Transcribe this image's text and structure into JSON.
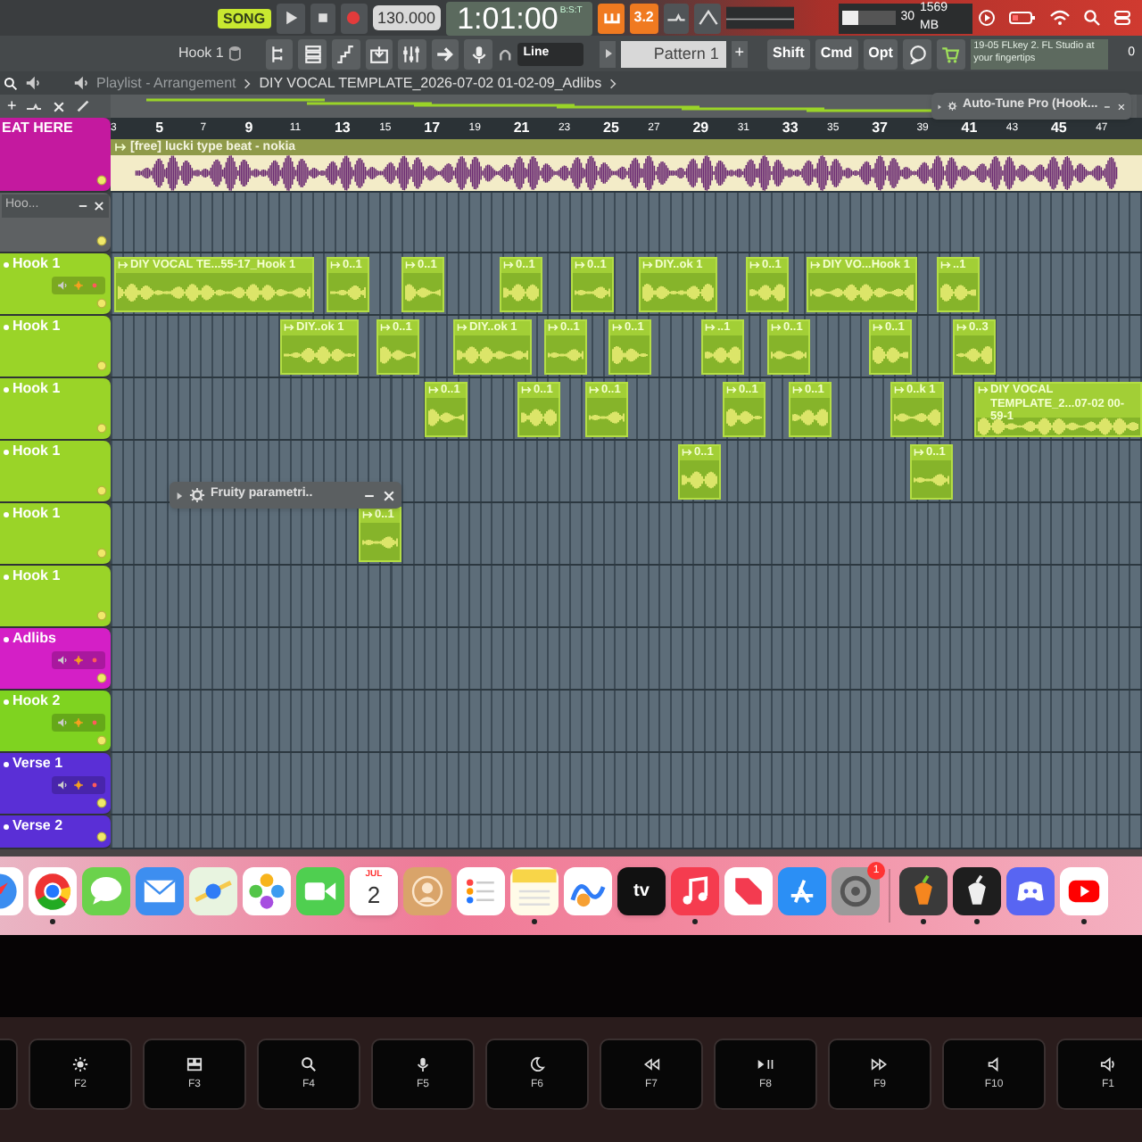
{
  "transport": {
    "mode": "SONG",
    "tempo": "130.000",
    "time": "1:01:00",
    "time_format": "B:S:T",
    "precount": "3.2"
  },
  "resources": {
    "cpu": "30",
    "level": 0.3,
    "memory": "1569 MB",
    "polyphony": "0"
  },
  "toolbar": {
    "channel": "Hook 1",
    "snap": "Line",
    "pattern": "Pattern 1",
    "add_pattern": "+",
    "add_track": "+",
    "modifiers": [
      "Shift",
      "Cmd",
      "Opt"
    ],
    "hint": "19-05 FLkey 2. FL Studio at your fingertips"
  },
  "playlist": {
    "title": "Playlist - Arrangement",
    "path": "DIY VOCAL TEMPLATE_2026-07-02 01-02-09_Adlibs",
    "ruler": [
      "3",
      "5",
      "7",
      "9",
      "11",
      "13",
      "15",
      "17",
      "19",
      "21",
      "23",
      "25",
      "27",
      "29",
      "31",
      "33",
      "35",
      "37",
      "39",
      "41",
      "43",
      "45",
      "47"
    ],
    "tracks": [
      {
        "name": "EAT HERE",
        "color": "#c4199f",
        "kind": "audio",
        "controls": false,
        "clips": [
          {
            "label": "[free] lucki type beat - nokia"
          }
        ]
      },
      {
        "name": "Hoo...",
        "color": "#5e6163",
        "kind": "window",
        "controls": false
      },
      {
        "name": "Hook 1",
        "color": "#9ad428",
        "kind": "lane",
        "controls": true,
        "clips": [
          {
            "label": "DIY VOCAL TE...55-17_Hook 1"
          },
          {
            "label": "0..1"
          },
          {
            "label": "0..1"
          },
          {
            "label": "0..1"
          },
          {
            "label": "0..1"
          },
          {
            "label": "DIY..ok 1"
          },
          {
            "label": "0..1"
          },
          {
            "label": "DIY VO...Hook 1"
          },
          {
            "label": "..1"
          }
        ]
      },
      {
        "name": "Hook 1",
        "color": "#9ad428",
        "kind": "lane",
        "controls": false,
        "clips": [
          {
            "label": "DIY..ok 1"
          },
          {
            "label": "0..1"
          },
          {
            "label": "DIY..ok 1"
          },
          {
            "label": "0..1"
          },
          {
            "label": "0..1"
          },
          {
            "label": "..1"
          },
          {
            "label": "0..1"
          },
          {
            "label": "0..1"
          },
          {
            "label": "0..3"
          }
        ]
      },
      {
        "name": "Hook 1",
        "color": "#9ad428",
        "kind": "lane",
        "controls": false,
        "clips": [
          {
            "label": "0..1"
          },
          {
            "label": "0..1"
          },
          {
            "label": "0..1"
          },
          {
            "label": "0..1"
          },
          {
            "label": "0..1"
          },
          {
            "label": "0..k 1"
          },
          {
            "label": "DIY VOCAL TEMPLATE_2...07-02 00-59-1"
          }
        ]
      },
      {
        "name": "Hook 1",
        "color": "#9ad428",
        "kind": "lane",
        "controls": false,
        "clips": [
          {
            "label": "0..1"
          },
          {
            "label": "0..1"
          }
        ]
      },
      {
        "name": "Hook 1",
        "color": "#9ad428",
        "kind": "lane",
        "controls": false,
        "clips": [
          {
            "label": "0..1"
          }
        ]
      },
      {
        "name": "Hook 1",
        "color": "#9ad428",
        "kind": "lane",
        "controls": false
      },
      {
        "name": "Adlibs",
        "color": "#d41fc6",
        "kind": "lane",
        "controls": true
      },
      {
        "name": "Hook 2",
        "color": "#7fd320",
        "kind": "lane",
        "controls": true
      },
      {
        "name": "Verse 1",
        "color": "#5a2fd6",
        "kind": "lane",
        "controls": true
      },
      {
        "name": "Verse 2",
        "color": "#5a2fd6",
        "kind": "lane",
        "controls": false
      }
    ]
  },
  "plugin_windows": [
    {
      "title": "Auto-Tune Pro (Hook..."
    },
    {
      "title": "Fruity parametri.."
    }
  ],
  "dock": [
    {
      "kind": "compass",
      "running": false
    },
    {
      "kind": "ball",
      "running": true
    },
    {
      "kind": "chat",
      "running": false
    },
    {
      "kind": "mail",
      "running": false
    },
    {
      "kind": "map",
      "running": false
    },
    {
      "kind": "flower",
      "running": false
    },
    {
      "kind": "video",
      "running": false
    },
    {
      "kind": "calendar",
      "running": false,
      "month": "JUL",
      "day": "2"
    },
    {
      "kind": "contacts",
      "running": false
    },
    {
      "kind": "list",
      "running": false
    },
    {
      "kind": "notes",
      "running": true
    },
    {
      "kind": "freeform",
      "running": false
    },
    {
      "kind": "tv",
      "running": false,
      "label": "tv"
    },
    {
      "kind": "music",
      "running": true
    },
    {
      "kind": "news",
      "running": false
    },
    {
      "kind": "store",
      "running": false
    },
    {
      "kind": "settings",
      "running": false,
      "badge": "1"
    },
    {
      "kind": "fruit",
      "running": true
    },
    {
      "kind": "fruit_dark",
      "running": true
    },
    {
      "kind": "controller",
      "running": false
    },
    {
      "kind": "play",
      "running": true
    }
  ],
  "keyboard": [
    {
      "label": "F2",
      "kind": "brightness"
    },
    {
      "label": "F3",
      "kind": "windows"
    },
    {
      "label": "F4",
      "kind": "search"
    },
    {
      "label": "F5",
      "kind": "mic"
    },
    {
      "label": "F6",
      "kind": "moon"
    },
    {
      "label": "F7",
      "kind": "rewind"
    },
    {
      "label": "F8",
      "kind": "playpause"
    },
    {
      "label": "F9",
      "kind": "forward"
    },
    {
      "label": "F10",
      "kind": "mute"
    },
    {
      "label": "F1",
      "kind": "volume"
    }
  ]
}
